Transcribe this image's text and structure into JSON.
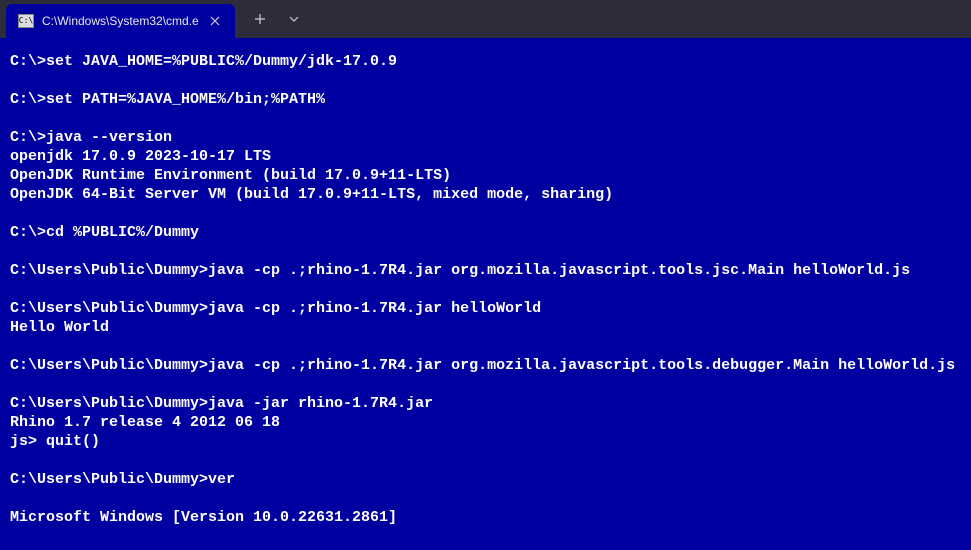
{
  "tab": {
    "icon_label": "C:\\",
    "title": "C:\\Windows\\System32\\cmd.e",
    "close_glyph": "✕"
  },
  "titlebar": {
    "new_tab_glyph": "+",
    "dropdown_glyph": "⌄"
  },
  "terminal": {
    "lines": [
      "C:\\>set JAVA_HOME=%PUBLIC%/Dummy/jdk-17.0.9",
      "",
      "C:\\>set PATH=%JAVA_HOME%/bin;%PATH%",
      "",
      "C:\\>java --version",
      "openjdk 17.0.9 2023-10-17 LTS",
      "OpenJDK Runtime Environment (build 17.0.9+11-LTS)",
      "OpenJDK 64-Bit Server VM (build 17.0.9+11-LTS, mixed mode, sharing)",
      "",
      "C:\\>cd %PUBLIC%/Dummy",
      "",
      "C:\\Users\\Public\\Dummy>java -cp .;rhino-1.7R4.jar org.mozilla.javascript.tools.jsc.Main helloWorld.js",
      "",
      "C:\\Users\\Public\\Dummy>java -cp .;rhino-1.7R4.jar helloWorld",
      "Hello World",
      "",
      "C:\\Users\\Public\\Dummy>java -cp .;rhino-1.7R4.jar org.mozilla.javascript.tools.debugger.Main helloWorld.js",
      "",
      "C:\\Users\\Public\\Dummy>java -jar rhino-1.7R4.jar",
      "Rhino 1.7 release 4 2012 06 18",
      "js> quit()",
      "",
      "C:\\Users\\Public\\Dummy>ver",
      "",
      "Microsoft Windows [Version 10.0.22631.2861]"
    ]
  }
}
